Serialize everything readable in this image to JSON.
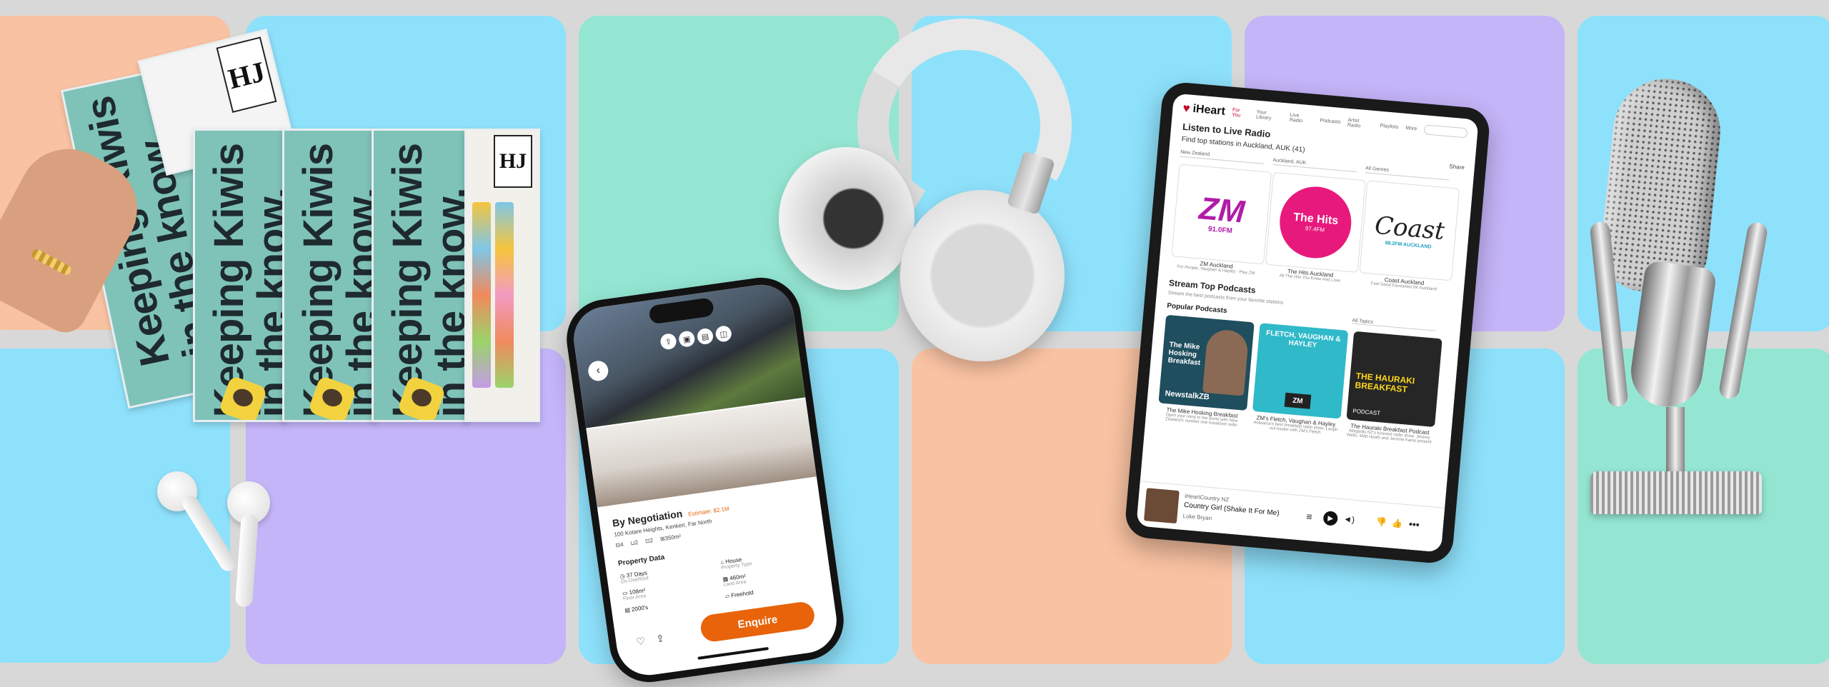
{
  "colors": {
    "peach": "#f9c2a2",
    "sky": "#8ee1fb",
    "mint": "#94e6d3",
    "lavender": "#c4b4f8",
    "background": "#d8d8d8",
    "iheart_red": "#c6002b",
    "enquire_orange": "#e8630a"
  },
  "newspaper": {
    "masthead": "HJ",
    "headline": "Keeping Kiwis\nin the know."
  },
  "phone": {
    "title": "By Negotiation",
    "estimate": "Estimate: $2.1M",
    "address": "100 Kotare Heights, Kerikeri, Far North",
    "specs": [
      "4",
      "2",
      "2",
      "350m²"
    ],
    "section": "Property Data",
    "data": [
      {
        "value": "37 Days",
        "label": "On OneRoof"
      },
      {
        "value": "House",
        "label": "Property Type"
      },
      {
        "value": "108m²",
        "label": "Floor Area"
      },
      {
        "value": "460m²",
        "label": "Land Area"
      },
      {
        "value": "2000's",
        "label": ""
      },
      {
        "value": "Freehold",
        "label": ""
      }
    ],
    "enquire": "Enquire"
  },
  "tablet": {
    "brand": "iHeart",
    "nav": [
      "For You",
      "Your Library",
      "Live Radio",
      "Podcasts",
      "Artist Radio",
      "Playlists",
      "More"
    ],
    "heading": "Listen to Live Radio",
    "subheading": "Find top stations in Auckland, AUK (41)",
    "share": "Share",
    "filters": [
      "New Zealand",
      "Auckland, AUK",
      "All Genres"
    ],
    "stations": [
      {
        "logo": "ZM",
        "freq": "91.0FM",
        "name": "ZM Auckland",
        "desc": "For People, Vaughan & Hayley - Play ZM"
      },
      {
        "logo": "The Hits",
        "freq": "97.4FM",
        "name": "The Hits Auckland",
        "desc": "All The Hits You Know And Love"
      },
      {
        "logo": "Coast",
        "freq": "98.2FM AUCKLAND",
        "name": "Coast Auckland",
        "desc": "Feel Good Favourites for Auckland"
      }
    ],
    "stream_heading": "Stream Top Podcasts",
    "stream_sub": "Stream the best podcasts from your favorite stations",
    "popular": "Popular Podcasts",
    "topics": "All Topics",
    "podcasts": [
      {
        "art": "The Mike Hosking Breakfast",
        "brand": "NewstalkZB",
        "name": "The Mike Hosking Breakfast",
        "desc": "Open your mind to the world with New Zealand's number one breakfast radio"
      },
      {
        "art": "FLETCH, VAUGHAN & HAYLEY",
        "brand": "ZM",
        "name": "ZM's Fletch, Vaughan & Hayley",
        "desc": "Aotearoa's best breakfast radio show. Laugh out louder with ZM's Fletch"
      },
      {
        "art": "THE HAURAKI BREAKFAST",
        "brand": "PODCAST",
        "name": "The Hauraki Breakfast Podcast",
        "desc": "Allegedly NZ's funniest radio show. Jeremy Wells, Matt Heath and Jerome Kaino present"
      }
    ],
    "player": {
      "station": "iHeartCountry NZ",
      "song": "Country Girl (Shake It For Me)",
      "artist": "Luke Bryan"
    }
  }
}
